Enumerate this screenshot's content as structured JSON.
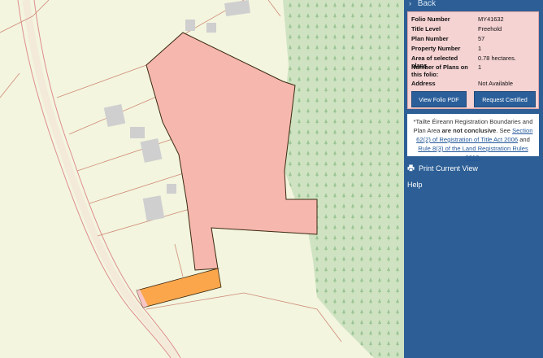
{
  "panel": {
    "back_label": "Back",
    "folio_details": [
      {
        "label": "Folio Number",
        "value": "MY41632"
      },
      {
        "label": "Title Level",
        "value": "Freehold"
      },
      {
        "label": "Plan Number",
        "value": "57"
      },
      {
        "label": "Property Number",
        "value": "1"
      },
      {
        "label": "Area of selected plans",
        "value": "0.78 hectares."
      },
      {
        "label": "Number of Plans on this folio:",
        "value": "1"
      },
      {
        "label": "Address",
        "value": "Not Available"
      }
    ],
    "buttons": {
      "view_pdf": "View Folio PDF",
      "request_copy": "Request Certified Copy"
    },
    "notice": {
      "part1": "*Tailte Éireann Registration Boundaries and Plan Area ",
      "emphasis": "are not conclusive",
      "part2": ". See ",
      "link1": "Section 62(2) of Registration of Title Act 2006",
      "part3": " and ",
      "link2": "Rule 8(3) of the Land Registration Rules 2012",
      "part4": "."
    },
    "menu": {
      "print": "Print Current View",
      "help": "Help"
    }
  },
  "map": {
    "colors": {
      "land": "#f3f5df",
      "forest": "#cfe3c2",
      "selected_plan": "#f6b7ae",
      "selected_border": "#3a2a10",
      "orange_strip": "#fba64b",
      "pink_strip": "#f7c5c5",
      "buildings": "#cfcfcf",
      "road_line": "#df8d8d",
      "panel_bg": "#2d5f96",
      "info_bg": "#f6d3d3"
    }
  }
}
